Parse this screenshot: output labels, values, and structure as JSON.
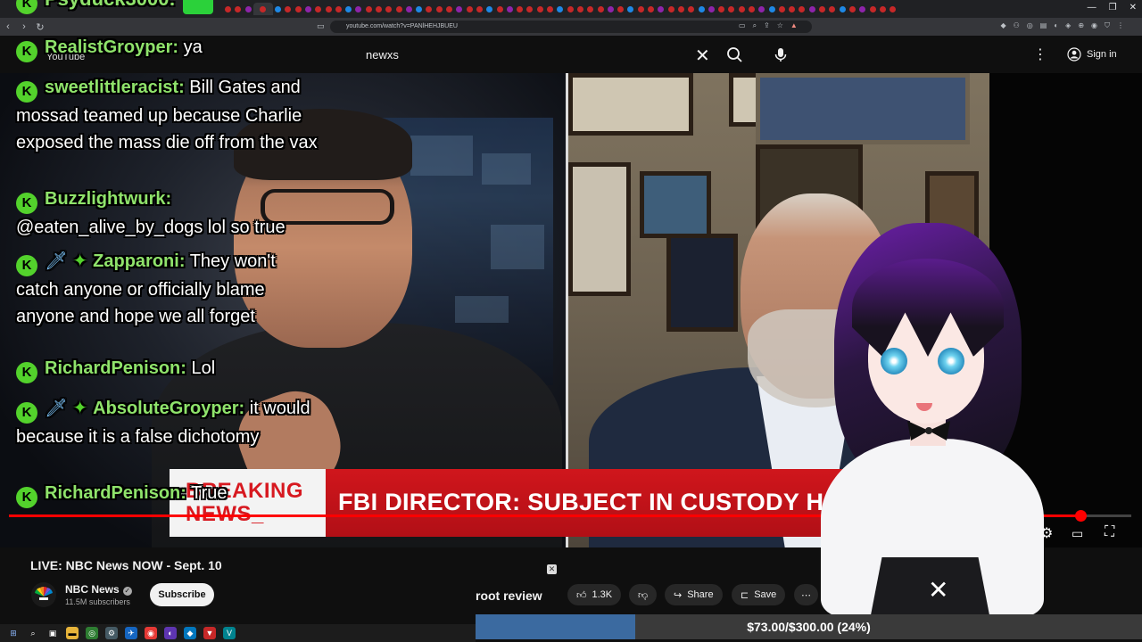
{
  "browser": {
    "url": "youtube.com/watch?v=PANlHEHJBUEU",
    "tab_count": 66,
    "active_tab_index": 3
  },
  "youtube": {
    "logo_text": "YouTube",
    "search_query": "newxs",
    "sign_in_label": "Sign in"
  },
  "overlay": {
    "top_partial_name": "Psyduck3000:",
    "breaking_label_line1": "BREAKING",
    "breaking_label_line2": "NEWS_",
    "headline": "FBI DIRECTOR: SUBJECT IN CUSTODY HAS BEEN RELE"
  },
  "chat": [
    {
      "user": "RealistGroyper:",
      "text": "ya",
      "badges": [
        "k"
      ]
    },
    {
      "user": "sweetlittleracist:",
      "text": "Bill Gates and mossad teamed up because Charlie exposed the mass die off from the vax",
      "badges": [
        "k"
      ]
    },
    {
      "user": "Buzzlightwurk:",
      "text": "@eaten_alive_by_dogs lol so true",
      "badges": [
        "k"
      ]
    },
    {
      "user": "Zapparoni:",
      "text": "They won't catch anyone or officially blame anyone and hope we all forget",
      "badges": [
        "k",
        "sword",
        "gem"
      ]
    },
    {
      "user": "RichardPenison:",
      "text": "Lol",
      "badges": [
        "k"
      ]
    },
    {
      "user": "AbsoluteGroyper:",
      "text": "it would because it is a false dichotomy",
      "badges": [
        "k",
        "sword",
        "gem"
      ]
    },
    {
      "user": "RichardPenison:",
      "text": "True",
      "badges": [
        "k"
      ]
    }
  ],
  "video": {
    "title": "LIVE: NBC News NOW - Sept. 10",
    "progress_fraction": 0.955,
    "channel_name": "NBC News",
    "subscribers": "11.5M subscribers",
    "subscribe_label": "Subscribe",
    "likes": "1.3K",
    "share_label": "Share",
    "save_label": "Save"
  },
  "stream": {
    "root_review_label": "root review",
    "donation_text": "$73.00/$300.00 (24%)",
    "donation_fraction": 0.24
  },
  "colors": {
    "chat_username": "#8fe36b",
    "badge_green": "#53d22c",
    "breaking_red": "#d71920",
    "progress_red": "#ff0000",
    "donation_fill": "#3b6aa0"
  }
}
